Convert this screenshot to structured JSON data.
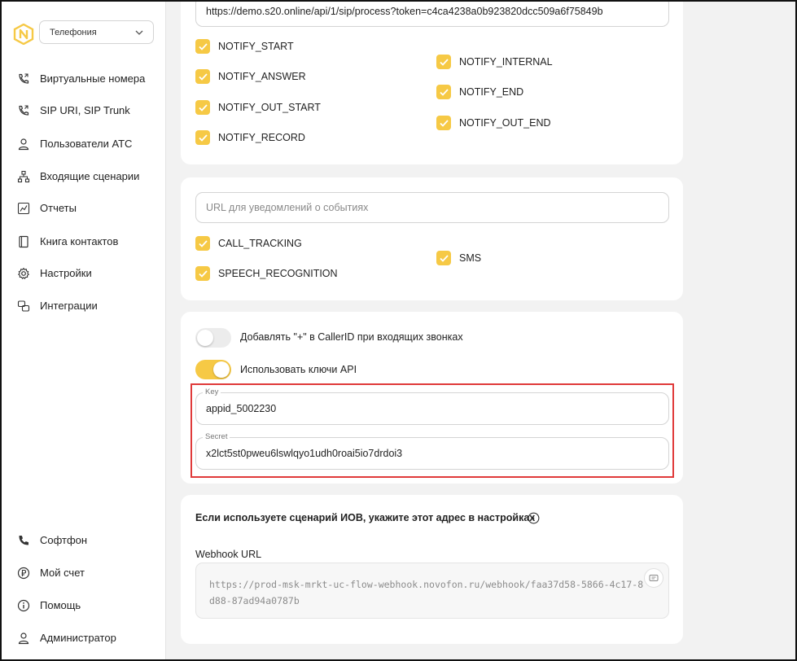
{
  "sidebar": {
    "section_select": "Телефония",
    "nav_top": [
      {
        "label": "Виртуальные номера",
        "icon": "phone-forward-icon"
      },
      {
        "label": "SIP URI, SIP Trunk",
        "icon": "phone-forward-icon"
      },
      {
        "label": "Пользователи АТС",
        "icon": "user-icon"
      },
      {
        "label": "Входящие сценарии",
        "icon": "hierarchy-icon"
      },
      {
        "label": "Отчеты",
        "icon": "chart-icon"
      },
      {
        "label": "Книга контактов",
        "icon": "contact-book-icon"
      },
      {
        "label": "Настройки",
        "icon": "gear-icon"
      },
      {
        "label": "Интеграции",
        "icon": "integrations-icon"
      }
    ],
    "nav_bottom": [
      {
        "label": "Софтфон",
        "icon": "phone-icon"
      },
      {
        "label": "Мой счет",
        "icon": "ruble-icon"
      },
      {
        "label": "Помощь",
        "icon": "info-icon"
      },
      {
        "label": "Администратор",
        "icon": "user-icon"
      }
    ]
  },
  "notify_card": {
    "url_value": "https://demo.s20.online/api/1/sip/process?token=c4ca4238a0b923820dcc509a6f75849b",
    "checks_left": [
      "NOTIFY_START",
      "NOTIFY_ANSWER",
      "NOTIFY_OUT_START",
      "NOTIFY_RECORD"
    ],
    "checks_right": [
      "NOTIFY_INTERNAL",
      "NOTIFY_END",
      "NOTIFY_OUT_END"
    ]
  },
  "events_card": {
    "url_placeholder": "URL для уведомлений о событиях",
    "checks_left": [
      "CALL_TRACKING",
      "SPEECH_RECOGNITION"
    ],
    "checks_right": [
      "SMS"
    ]
  },
  "api_card": {
    "toggle_plus_label": "Добавлять \"+\" в CallerID при входящих звонках",
    "toggle_plus_on": false,
    "toggle_api_label": "Использовать ключи API",
    "toggle_api_on": true,
    "key_label": "Key",
    "key_value": "appid_5002230",
    "secret_label": "Secret",
    "secret_value": "x2lct5st0pweu6lswlqyo1udh0roai5io7drdoi3"
  },
  "ivr_card": {
    "title": "Если используете сценарий ИОВ, укажите этот адрес в настройках",
    "webhook_label": "Webhook URL",
    "webhook_value": "https://prod-msk-mrkt-uc-flow-webhook.novofon.ru/webhook/faa37d58-5866-4c17-8d88-87ad94a0787b"
  },
  "colors": {
    "accent": "#f6c945",
    "highlight": "#e03a3a"
  }
}
